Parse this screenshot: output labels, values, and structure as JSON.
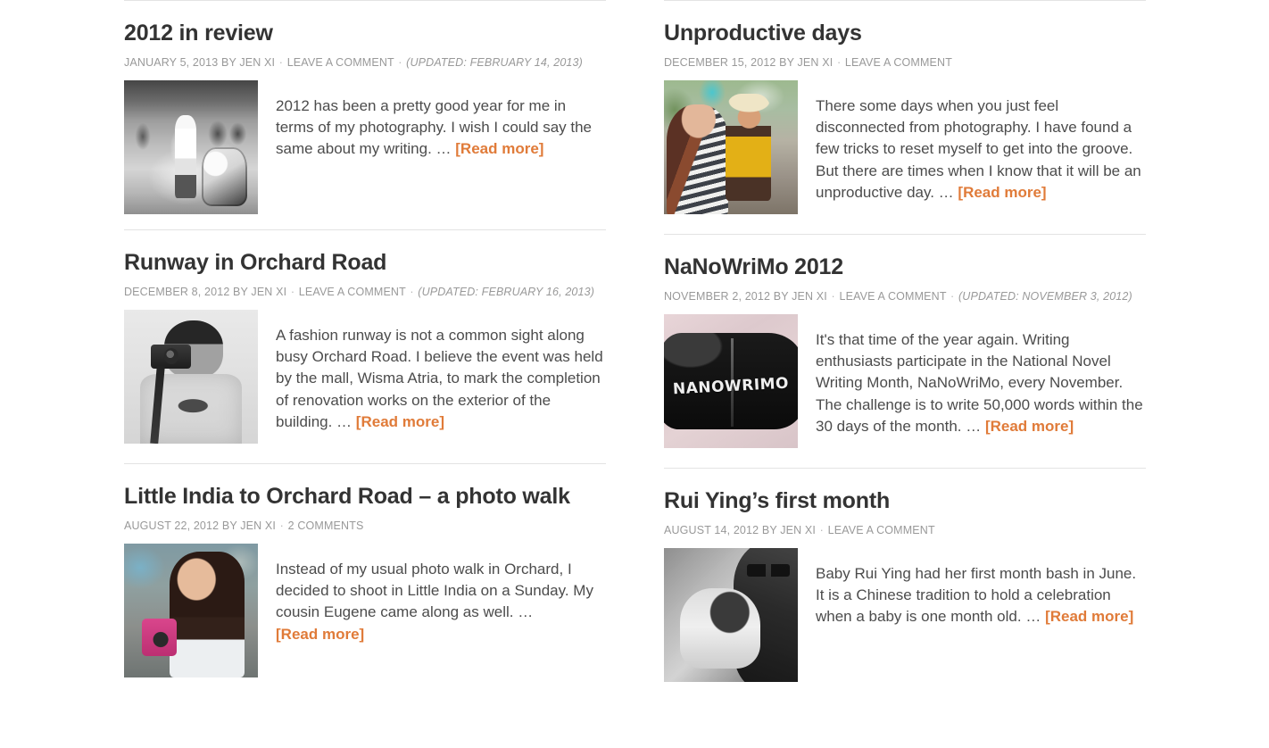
{
  "site": {
    "accent_color": "#e07b39",
    "title_color": "#333333",
    "meta_color": "#999999",
    "body_color": "#4c4c4c"
  },
  "posts": [
    {
      "title": "2012 in review",
      "date": "JANUARY 5, 2013",
      "by": "BY JEN XI",
      "comments": "LEAVE A COMMENT",
      "updated": "(UPDATED: FEBRUARY 14, 2013)",
      "excerpt": "2012 has been a pretty good year for me in terms of my photography. I wish I could say the same about my writing.  …",
      "read_more": "[Read more]",
      "thumb_alt": "black-and-white street photo of girl on a scooter beside a woman pushing a stroller",
      "thumb_style": "ph-street-bw",
      "column": "left"
    },
    {
      "title": "Unproductive days",
      "date": "DECEMBER 15, 2012",
      "by": "BY JEN XI",
      "comments": "LEAVE A COMMENT",
      "updated": "",
      "excerpt": "There some days when you just feel disconnected from photography. I have found a few tricks to reset myself to get into the groove. But there are times when I know that it will be an unproductive day. …",
      "read_more": "[Read more]",
      "thumb_alt": "color street photo of a woman in a striped top and a man in a yellow OLD SCHOOL t-shirt",
      "thumb_style": "ph-street-color",
      "column": "right"
    },
    {
      "title": "Runway in Orchard Road",
      "date": "DECEMBER 8, 2012",
      "by": "BY JEN XI",
      "comments": "LEAVE A COMMENT",
      "updated": "(UPDATED: FEBRUARY 16, 2013)",
      "excerpt": "A fashion runway is not a common sight along busy Orchard Road. I believe the event was held by the mall, Wisma Atria, to mark the completion of  renovation works on the exterior of the building. …",
      "read_more": "[Read more]",
      "thumb_alt": "black-and-white self portrait of a person holding a camera wearing an X100 t-shirt",
      "thumb_style": "ph-portrait-bw",
      "column": "left"
    },
    {
      "title": "NaNoWriMo 2012",
      "date": "NOVEMBER 2, 2012",
      "by": "BY JEN XI",
      "comments": "LEAVE A COMMENT",
      "updated": "(UPDATED: NOVEMBER 3, 2012)",
      "excerpt": "It's that time of the year again. Writing enthusiasts participate in the National Novel Writing Month, NaNoWriMo, every November. The challenge is to write 50,000 words within the 30 days of the month. …",
      "read_more": "[Read more]",
      "thumb_alt": "black hoodie with NANOWRIMO printed across the front lying on a pink sheet",
      "thumb_style": "ph-hoodie",
      "thumb_text": "NANOWRIMO",
      "column": "right"
    },
    {
      "title": "Little India to Orchard Road – a photo walk",
      "date": "AUGUST 22, 2012",
      "by": "BY JEN XI",
      "comments": "2 COMMENTS",
      "updated": "",
      "excerpt": "Instead of my usual photo walk in Orchard, I decided to shoot in Little India on a Sunday. My cousin Eugene came along as well. …",
      "read_more": "[Read more]",
      "thumb_alt": "color portrait of a smiling woman holding a pink camera on a street",
      "thumb_style": "ph-girl-camera",
      "column": "left"
    },
    {
      "title": "Rui Ying’s first month",
      "date": "AUGUST 14, 2012",
      "by": "BY JEN XI",
      "comments": "LEAVE A COMMENT",
      "updated": "",
      "excerpt": "Baby Rui Ying had her first month bash in June. It is a Chinese tradition to hold a celebration when a baby is one month old. …",
      "read_more": "[Read more]",
      "thumb_alt": "black-and-white photo of a man in glasses holding a newborn baby",
      "thumb_style": "ph-baby-bw",
      "column": "right"
    }
  ],
  "separator": "·"
}
